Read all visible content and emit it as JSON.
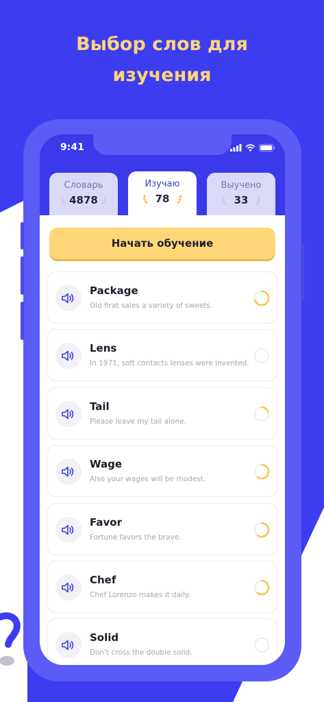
{
  "headline": {
    "line1": "Выбор слов для",
    "line2": "изучения"
  },
  "colors": {
    "background": "#3C3CF0",
    "headline": "#FFD57A",
    "accent": "#FFD778",
    "phone": "#5B5BF6"
  },
  "status_bar": {
    "time": "9:41",
    "icons": [
      "signal-icon",
      "wifi-icon",
      "battery-icon"
    ]
  },
  "tabs": [
    {
      "label": "Словарь",
      "count": "4878",
      "active": false
    },
    {
      "label": "Изучаю",
      "count": "78",
      "active": true
    },
    {
      "label": "Выучено",
      "count": "33",
      "active": false
    }
  ],
  "start_button": {
    "label": "Начать обучение"
  },
  "words": [
    {
      "word": "Package",
      "example": "Old firat sales a variety of sweets.",
      "progress": 0.7
    },
    {
      "word": "Lens",
      "example": "In 1971, soft contacts lenses were invented.",
      "progress": 0
    },
    {
      "word": "Tail",
      "example": "Please leave my tail alone.",
      "progress": 0.2
    },
    {
      "word": "Wage",
      "example": "Also your wages will be modest.",
      "progress": 0.6
    },
    {
      "word": "Favor",
      "example": "Fortune favors the brave.",
      "progress": 0.6
    },
    {
      "word": "Chef",
      "example": "Chef Lorenzo makes it daily.",
      "progress": 0.6
    },
    {
      "word": "Solid",
      "example": "Don't cross the double solid.",
      "progress": 0
    }
  ]
}
